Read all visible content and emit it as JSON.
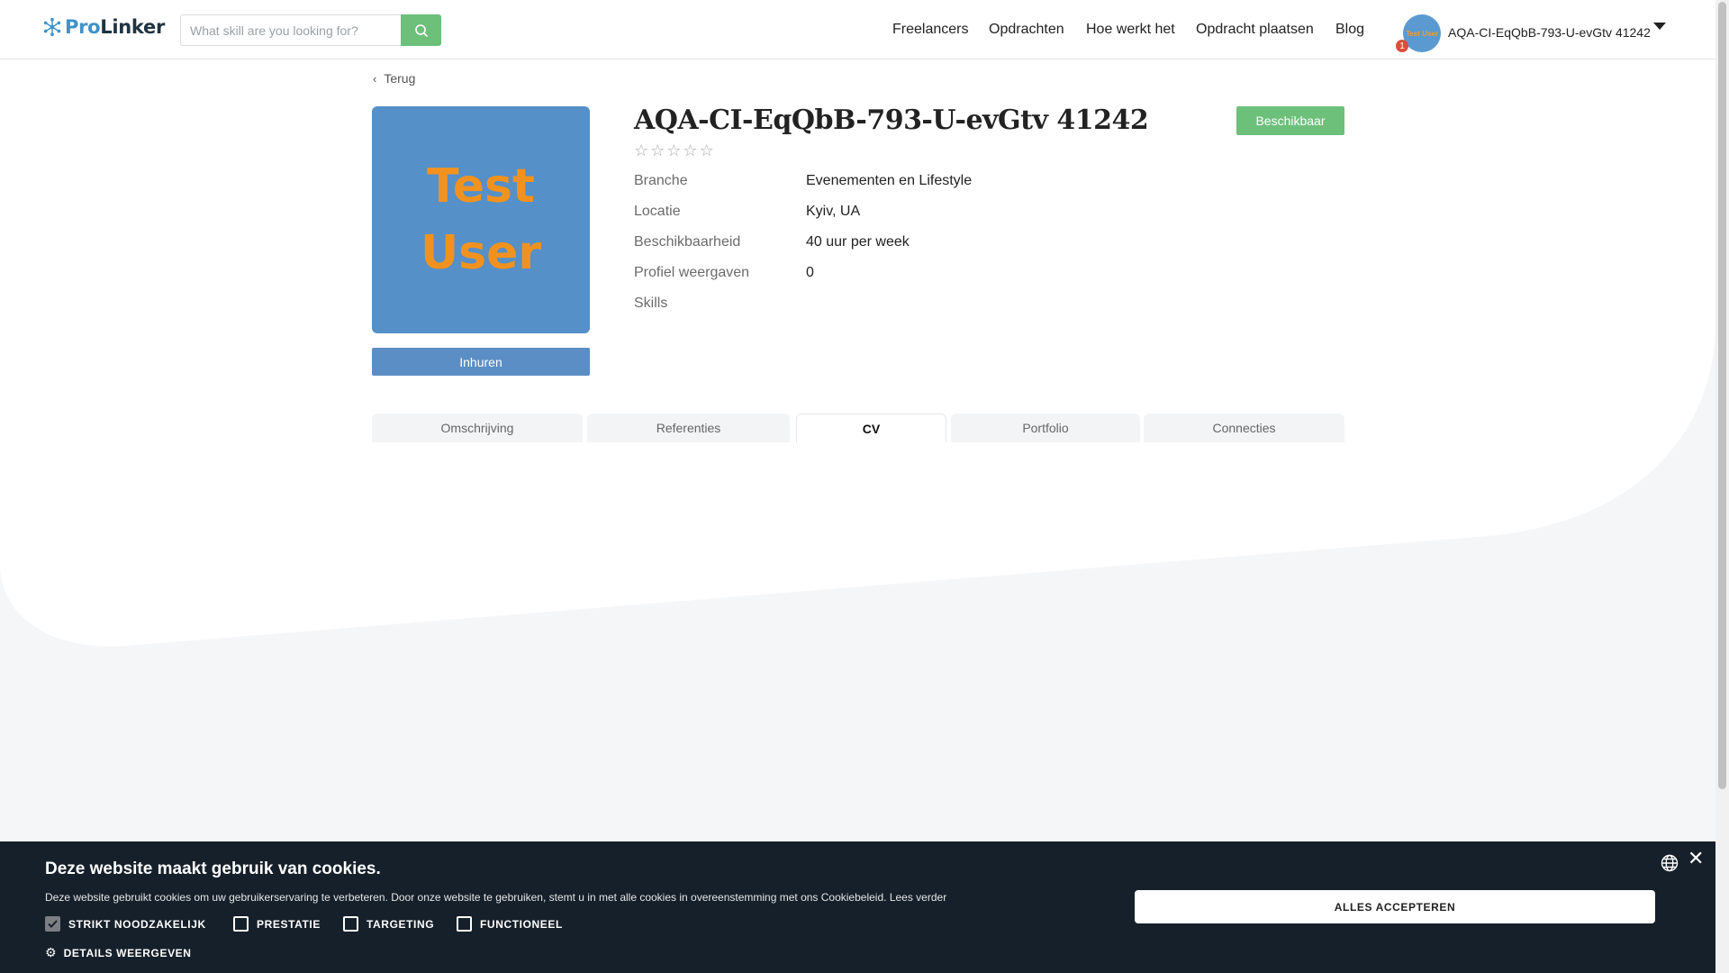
{
  "header": {
    "logo": {
      "pro": "Pro",
      "linker": "Linker"
    },
    "search": {
      "placeholder": "What skill are you looking for?"
    },
    "nav": [
      {
        "label": "Freelancers"
      },
      {
        "label": "Opdrachten"
      },
      {
        "label": "Hoe werkt het"
      },
      {
        "label": "Opdracht plaatsen"
      },
      {
        "label": "Blog"
      }
    ],
    "user": {
      "name": "AQA-CI-EqQbB-793-U-evGtv 41242",
      "avatar_text": "Test User",
      "notification_count": "1"
    }
  },
  "profile": {
    "back_label": "Terug",
    "photo_text_line1": "Test",
    "photo_text_line2": "User",
    "hire_label": "Inhuren",
    "name": "AQA-CI-EqQbB-793-U-evGtv 41242",
    "rating": 0,
    "rating_max": 5,
    "status_label": "Beschikbaar",
    "details": [
      {
        "label": "Branche",
        "value": "Evenementen en Lifestyle"
      },
      {
        "label": "Locatie",
        "value": "Kyiv, UA"
      },
      {
        "label": "Beschikbaarheid",
        "value": "40 uur per week"
      },
      {
        "label": "Profiel weergaven",
        "value": "0"
      },
      {
        "label": "Skills",
        "value": ""
      }
    ],
    "tabs": [
      {
        "label": "Omschrijving",
        "active": false
      },
      {
        "label": "Referenties",
        "active": false
      },
      {
        "label": "CV",
        "active": true
      },
      {
        "label": "Portfolio",
        "active": false
      },
      {
        "label": "Connecties",
        "active": false
      }
    ]
  },
  "cookie": {
    "title": "Deze website maakt gebruik van cookies.",
    "text": "Deze website gebruikt cookies om uw gebruikerservaring te verbeteren. Door onze website te gebruiken, stemt u in met alle cookies in overeenstemming met ons Cookiebeleid.",
    "read_more": "Lees verder",
    "options": [
      {
        "label": "STRIKT NOODZAKELIJK",
        "checked": true
      },
      {
        "label": "PRESTATIE",
        "checked": false
      },
      {
        "label": "TARGETING",
        "checked": false
      },
      {
        "label": "FUNCTIONEEL",
        "checked": false
      }
    ],
    "details_label": "DETAILS WEERGEVEN",
    "accept_label": "ALLES ACCEPTEREN"
  },
  "colors": {
    "brand_blue": "#3f93c9",
    "green": "#6cc07a",
    "hire_blue": "#5b8ec4",
    "cookie_bg": "#15202a"
  }
}
